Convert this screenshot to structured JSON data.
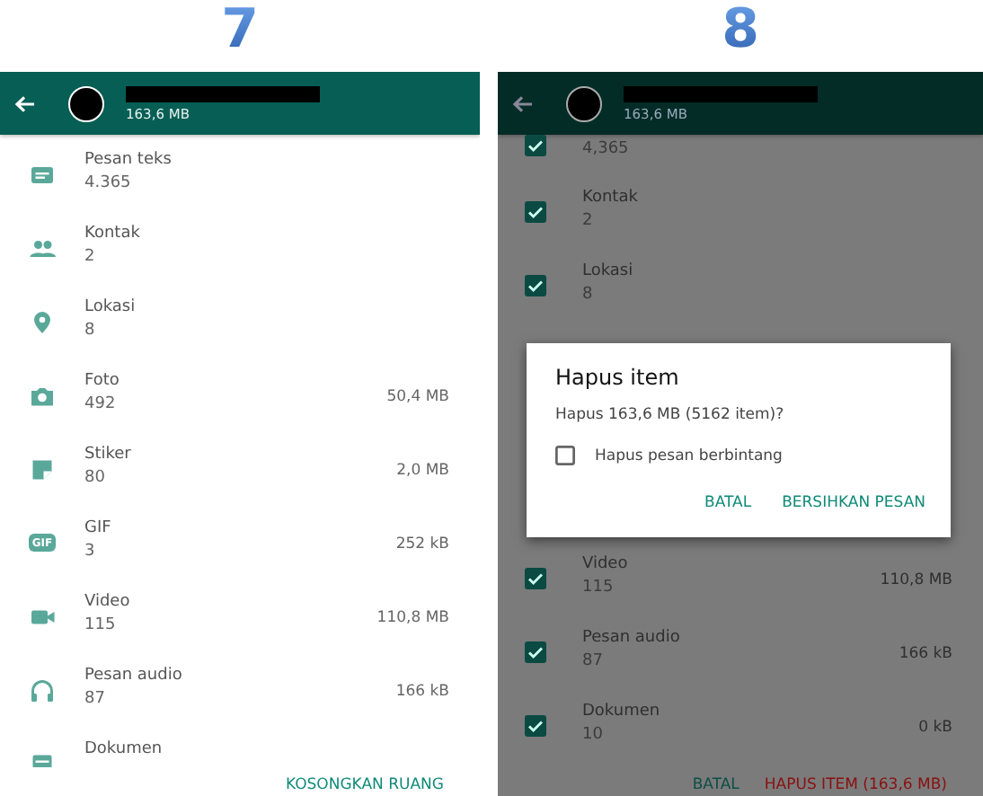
{
  "panels": [
    {
      "kind": "storage",
      "step": "7",
      "header": {
        "size": "163,6 MB"
      },
      "rows": [
        {
          "name": "Pesan teks",
          "count": "4.365"
        },
        {
          "name": "Kontak",
          "count": "2"
        },
        {
          "name": "Lokasi",
          "count": "8"
        },
        {
          "name": "Foto",
          "count": "492",
          "size": "50,4 MB"
        },
        {
          "name": "Stiker",
          "count": "80",
          "size": "2,0 MB"
        },
        {
          "name": "GIF",
          "count": "3",
          "size": "252 kB",
          "icon_text": "GIF"
        },
        {
          "name": "Video",
          "count": "115",
          "size": "110,8 MB"
        },
        {
          "name": "Pesan audio",
          "count": "87",
          "size": "166 kB"
        },
        {
          "name": "Dokumen"
        }
      ],
      "footer_buttons": [
        {
          "label": "KOSONGKAN RUANG",
          "kind": "primary"
        }
      ]
    },
    {
      "kind": "selection",
      "step": "8",
      "header": {
        "size": "163,6 MB"
      },
      "rows_above": [
        {
          "count": "4,365",
          "checked": true
        },
        {
          "name": "Kontak",
          "count": "2",
          "checked": true
        },
        {
          "name": "Lokasi",
          "count": "8",
          "checked": true
        }
      ],
      "dialog": {
        "title": "Hapus item",
        "message": "Hapus 163,6 MB (5162 item)?",
        "option": {
          "label": "Hapus pesan berbintang",
          "checked": false
        },
        "buttons": [
          "BATAL",
          "BERSIHKAN PESAN"
        ]
      },
      "rows_below": [
        {
          "name": "Video",
          "count": "115",
          "size": "110,8 MB",
          "checked": true
        },
        {
          "name": "Pesan audio",
          "count": "87",
          "size": "166 kB",
          "checked": true
        },
        {
          "name": "Dokumen",
          "count": "10",
          "size": "0 kB",
          "checked": true
        }
      ],
      "footer_buttons": [
        {
          "label": "BATAL",
          "kind": "neutral"
        },
        {
          "label": "HAPUS ITEM (163,6 MB)",
          "kind": "danger"
        }
      ]
    }
  ]
}
